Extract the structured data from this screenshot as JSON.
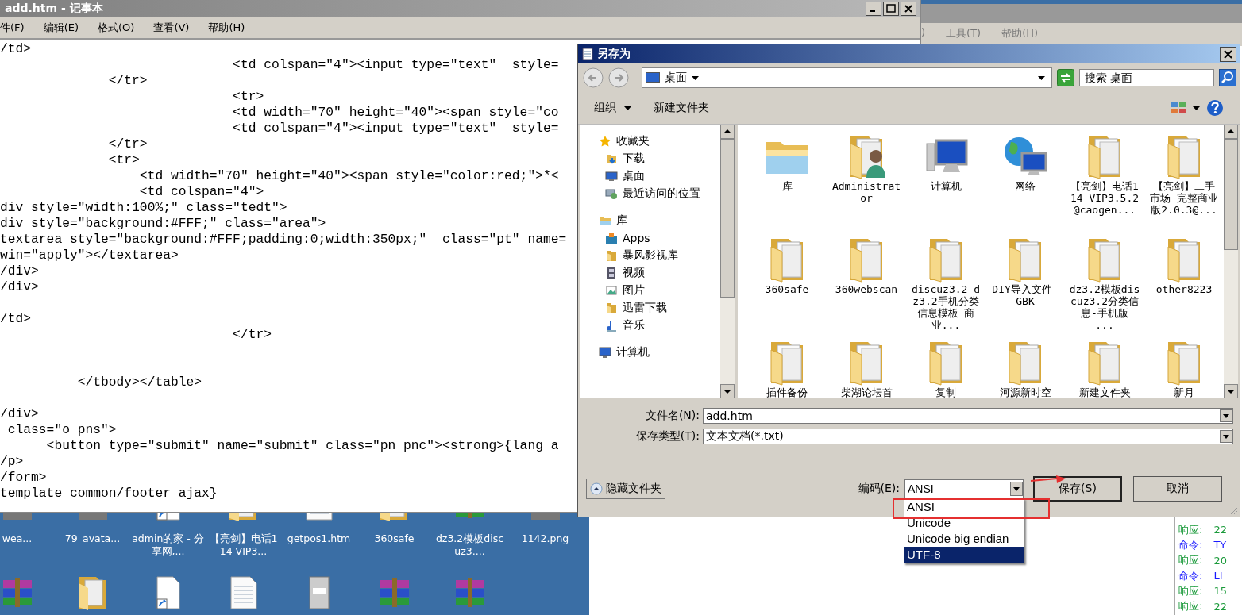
{
  "background_window": {
    "menu": [
      ")",
      "工具(T)",
      "帮助(H)"
    ]
  },
  "notepad": {
    "title": "add.htm - 记事本",
    "menu": [
      "件(F)",
      "编辑(E)",
      "格式(O)",
      "查看(V)",
      "帮助(H)"
    ],
    "lines": [
      {
        "kind": "code",
        "text": "/td>"
      },
      {
        "kind": "code",
        "text": "                              <td colspan=\"4\"><input type=\"text\"  style="
      },
      {
        "kind": "code",
        "text": "              </tr>"
      },
      {
        "kind": "code",
        "text": "                              <tr>"
      },
      {
        "kind": "code",
        "text": "                              <td width=\"70\" height=\"40\"><span style=\"co"
      },
      {
        "kind": "code",
        "text": "                              <td colspan=\"4\"><input type=\"text\"  style="
      },
      {
        "kind": "code",
        "text": "              </tr>"
      },
      {
        "kind": "code",
        "text": "              <tr>"
      },
      {
        "kind": "code",
        "text": "                  <td width=\"70\" height=\"40\"><span style=\"color:red;\">*<"
      },
      {
        "kind": "code",
        "text": "                  <td colspan=\"4\">"
      },
      {
        "kind": "code",
        "text": "div style=\"width:100%;\" class=\"tedt\">"
      },
      {
        "kind": "code",
        "text": "div style=\"background:#FFF;\" class=\"area\">"
      },
      {
        "kind": "code",
        "text": "textarea style=\"background:#FFF;padding:0;width:350px;\"  class=\"pt\" name="
      },
      {
        "kind": "code",
        "text": "win=\"apply\"></textarea>"
      },
      {
        "kind": "code",
        "text": "/div>"
      },
      {
        "kind": "code",
        "text": "/div>"
      },
      {
        "kind": "blank"
      },
      {
        "kind": "code",
        "text": "/td>"
      },
      {
        "kind": "code",
        "text": "                              </tr>"
      },
      {
        "kind": "blank"
      },
      {
        "kind": "blank"
      },
      {
        "kind": "code",
        "text": "          </tbody></table>"
      },
      {
        "kind": "blank"
      },
      {
        "kind": "code",
        "text": "/div>"
      },
      {
        "kind": "code",
        "text": " class=\"o pns\">"
      },
      {
        "kind": "code",
        "text": "      <button type=\"submit\" name=\"submit\" class=\"pn pnc\"><strong>{lang a"
      },
      {
        "kind": "code",
        "text": "/p>"
      },
      {
        "kind": "code",
        "text": "/form>"
      },
      {
        "kind": "code",
        "text": "template common/footer_ajax}"
      }
    ]
  },
  "save_dialog": {
    "title": "另存为",
    "location": "桌面",
    "search": {
      "placeholder": "搜索 桌面"
    },
    "toolbar": [
      {
        "kind": "menu",
        "label": "组织"
      },
      {
        "kind": "button",
        "label": "新建文件夹"
      }
    ],
    "nav": [
      {
        "kind": "favorites",
        "label": "收藏夹",
        "children": [
          {
            "kind": "download",
            "label": "下载"
          },
          {
            "kind": "desktop",
            "label": "桌面"
          },
          {
            "kind": "recent",
            "label": "最近访问的位置"
          }
        ]
      },
      {
        "kind": "library",
        "label": "库",
        "children": [
          {
            "kind": "apps",
            "label": "Apps"
          },
          {
            "kind": "folder",
            "label": "暴风影视库"
          },
          {
            "kind": "video",
            "label": "视频"
          },
          {
            "kind": "pictures",
            "label": "图片"
          },
          {
            "kind": "folder",
            "label": "迅雷下载"
          },
          {
            "kind": "music",
            "label": "音乐"
          }
        ]
      },
      {
        "kind": "computer",
        "label": "计算机"
      }
    ],
    "files": [
      {
        "kind": "library",
        "name": "库"
      },
      {
        "kind": "user",
        "name": "Administrator"
      },
      {
        "kind": "computer",
        "name": "计算机"
      },
      {
        "kind": "network",
        "name": "网络"
      },
      {
        "kind": "folder",
        "name": "【亮剑】电话114 VIP3.5.2@caogen..."
      },
      {
        "kind": "folder",
        "name": "【亮剑】二手市场 完整商业版2.0.3@..."
      },
      {
        "kind": "folder",
        "name": "360safe"
      },
      {
        "kind": "folder",
        "name": "360webscan"
      },
      {
        "kind": "folder",
        "name": "discuz3.2 dz3.2手机分类信息模板 商业..."
      },
      {
        "kind": "folder",
        "name": "DIY导入文件-GBK"
      },
      {
        "kind": "folder",
        "name": "dz3.2模板discuz3.2分类信息-手机版 ..."
      },
      {
        "kind": "folder",
        "name": "other8223"
      },
      {
        "kind": "folder",
        "name": "插件备份"
      },
      {
        "kind": "folder",
        "name": "柴湖论坛首"
      },
      {
        "kind": "folder",
        "name": "复制"
      },
      {
        "kind": "folder",
        "name": "河源新时空"
      },
      {
        "kind": "folder",
        "name": "新建文件夹"
      },
      {
        "kind": "folder",
        "name": "新月"
      }
    ],
    "file_name": {
      "label": "文件名(N):",
      "value": "add.htm"
    },
    "file_type": {
      "label": "保存类型(T):",
      "value": "文本文档(*.txt)"
    },
    "hide_folders": "隐藏文件夹",
    "encoding": {
      "label": "编码(E):",
      "value": "ANSI",
      "options": [
        {
          "label": "ANSI",
          "highlighted": false
        },
        {
          "label": "Unicode",
          "highlighted": false
        },
        {
          "label": "Unicode big endian",
          "highlighted": false
        },
        {
          "label": "UTF-8",
          "highlighted": true
        }
      ]
    },
    "buttons": [
      "保存(S)",
      "取消"
    ]
  },
  "desktop_icons": [
    {
      "kind": "image",
      "label": "wea..."
    },
    {
      "kind": "image",
      "label": "79_avata..."
    },
    {
      "kind": "shortcut",
      "label": "admin的家 - 分享网,..."
    },
    {
      "kind": "folder",
      "label": "【亮剑】电话114 VIP3..."
    },
    {
      "kind": "document",
      "label": "getpos1.htm"
    },
    {
      "kind": "folder",
      "label": "360safe"
    },
    {
      "kind": "archive",
      "label": "dz3.2模板discuz3...."
    },
    {
      "kind": "image",
      "label": "1142.png"
    },
    {
      "kind": "archive"
    },
    {
      "kind": "folder"
    },
    {
      "kind": "shortcut"
    },
    {
      "kind": "document"
    },
    {
      "kind": "device"
    },
    {
      "kind": "archive"
    },
    {
      "kind": "archive"
    }
  ],
  "log": [
    {
      "kind": "response",
      "label": "响应:",
      "value": "22"
    },
    {
      "kind": "command",
      "label": "命令:",
      "value": "TY"
    },
    {
      "kind": "response",
      "label": "响应:",
      "value": "20"
    },
    {
      "kind": "command",
      "label": "命令:",
      "value": "LI"
    },
    {
      "kind": "response",
      "label": "响应:",
      "value": "15"
    },
    {
      "kind": "response",
      "label": "响应:",
      "value": "22"
    }
  ]
}
